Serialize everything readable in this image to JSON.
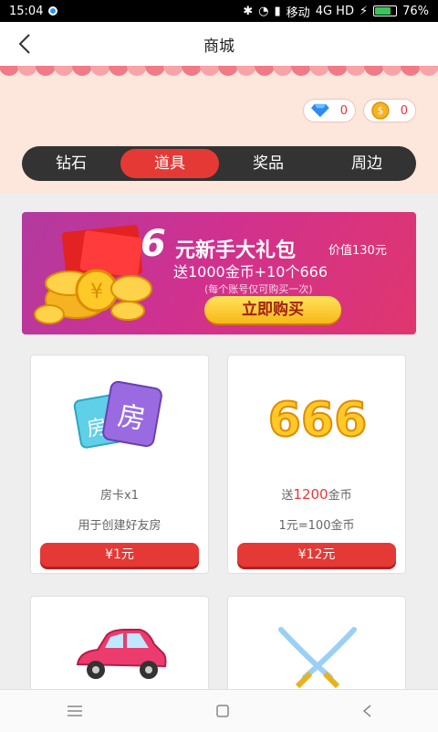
{
  "status": {
    "time": "15:04",
    "carrier": "移动",
    "network": "4G HD",
    "battery": "76%",
    "battery_level": 0.76
  },
  "header": {
    "title": "商城"
  },
  "currency": {
    "diamond_count": "0",
    "coin_count": "0"
  },
  "tabs": [
    {
      "label": "钻石",
      "active": false
    },
    {
      "label": "道具",
      "active": true
    },
    {
      "label": "奖品",
      "active": false
    },
    {
      "label": "周边",
      "active": false
    }
  ],
  "banner": {
    "headline_num": "6",
    "headline": "元新手大礼包",
    "worth": "价值130元",
    "subtitle": "送1000金币+10个666",
    "note": "(每个账号仅可购买一次)",
    "button": "立即购买"
  },
  "products": [
    {
      "name": "房卡x1",
      "desc": "用于创建好友房",
      "price": "¥1元",
      "icon_text": "房",
      "icon_text_small": "房"
    },
    {
      "name_prefix": "送",
      "name_highlight": "1200",
      "name_suffix": "金币",
      "desc": "1元=100金币",
      "price": "¥12元",
      "icon_text": "666"
    },
    {
      "icon": "car-icon"
    },
    {
      "icon": "crossed-swords-icon"
    }
  ],
  "colors": {
    "accent": "#e53935",
    "tab_bg": "#333333",
    "banner_bg": "#d0318f"
  }
}
